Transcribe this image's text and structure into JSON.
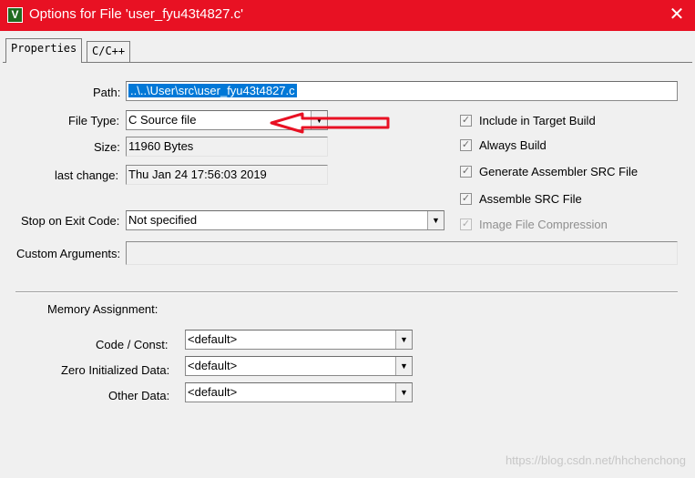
{
  "window": {
    "title": "Options for File 'user_fyu43t4827.c'",
    "icon_letter": "V",
    "close_glyph": "✕"
  },
  "tabs": [
    {
      "label": "Properties",
      "active": true
    },
    {
      "label": "C/C++",
      "active": false
    }
  ],
  "fields": {
    "path_label": "Path:",
    "path_value": "..\\..\\User\\src\\user_fyu43t4827.c",
    "file_type_label": "File Type:",
    "file_type_value": "C Source file",
    "size_label": "Size:",
    "size_value": "11960 Bytes",
    "last_change_label": "last change:",
    "last_change_value": "Thu Jan 24 17:56:03 2019",
    "stop_on_exit_label": "Stop on Exit Code:",
    "stop_on_exit_value": "Not specified",
    "custom_args_label": "Custom Arguments:",
    "custom_args_value": ""
  },
  "options": [
    {
      "label": "Include in Target Build",
      "checked": true,
      "enabled": true
    },
    {
      "label": "Always Build",
      "checked": true,
      "enabled": true
    },
    {
      "label": "Generate Assembler SRC File",
      "checked": true,
      "enabled": true
    },
    {
      "label": "Assemble SRC File",
      "checked": true,
      "enabled": true
    },
    {
      "label": "Image File Compression",
      "checked": true,
      "enabled": false
    }
  ],
  "memory": {
    "heading": "Memory Assignment:",
    "code_const_label": "Code / Const:",
    "code_const_value": "<default>",
    "zero_init_label": "Zero Initialized Data:",
    "zero_init_value": "<default>",
    "other_data_label": "Other Data:",
    "other_data_value": "<default>"
  },
  "annotation": {
    "color": "#e81123"
  },
  "watermark": "https://blog.csdn.net/hhchenchong",
  "colors": {
    "titlebar": "#e81123",
    "selection": "#0078d7",
    "background": "#f0f0f0"
  },
  "dropdown_glyph": "▼",
  "check_glyph": "✓"
}
